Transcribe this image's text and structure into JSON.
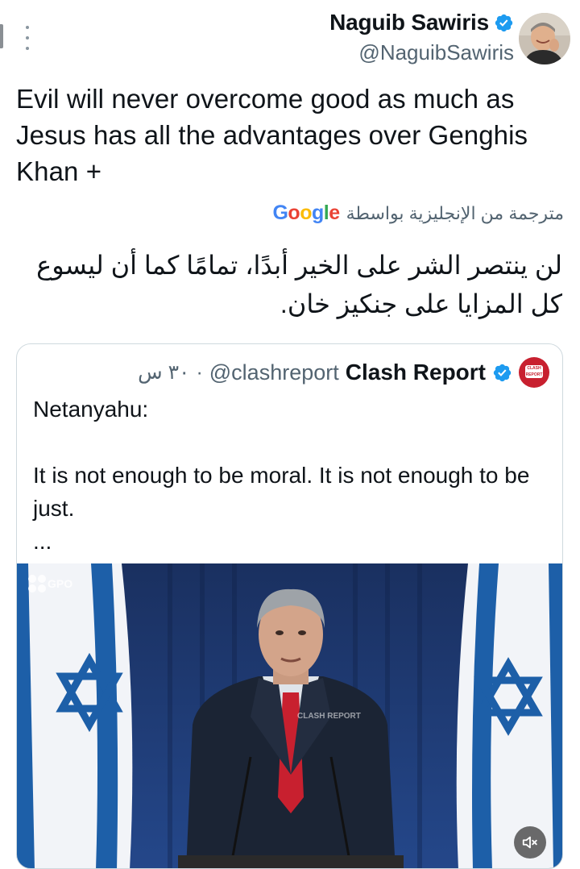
{
  "author": {
    "name": "Naguib Sawiris",
    "handle": "@NaguibSawiris",
    "verified": true
  },
  "tweet": {
    "text": "Evil will never overcome good as much as Jesus has all the advantages over Genghis Khan +"
  },
  "translation": {
    "label": "مترجمة من الإنجليزية بواسطة",
    "provider": "Google",
    "text": "لن ينتصر الشر على الخير أبدًا، تمامًا كما أن ليسوع كل المزايا على جنكيز خان."
  },
  "quoted_tweet": {
    "author_name": "Clash Report",
    "handle": "@clashreport",
    "separator": "·",
    "time": "٣٠ س",
    "lines": [
      "Netanyahu:",
      "",
      "It is not enough to be moral. It is not enough to be just.",
      "..."
    ],
    "media": {
      "watermark": "GPO",
      "center_watermark": "CLASH REPORT",
      "mute_icon": "speaker-muted-icon"
    }
  },
  "colors": {
    "text": "#0f1419",
    "secondary": "#536471",
    "verified": "#1d9bf0",
    "clash_red": "#c8202f",
    "flag_blue": "#1d5fa8",
    "backdrop": "#1f3d72"
  },
  "icons": {
    "more": "more-vertical-icon",
    "verified": "verified-badge-icon",
    "google": "google-logo"
  }
}
